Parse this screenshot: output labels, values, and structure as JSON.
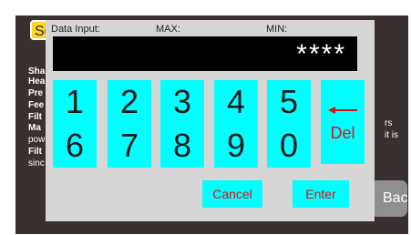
{
  "background": {
    "top_button_label": "Se",
    "labels": [
      "Sha",
      "Hea",
      "Pre",
      "Fee",
      "Filt",
      "Ma",
      "pow",
      "Filt",
      "sinc"
    ],
    "right_text": [
      "rs",
      "it is"
    ],
    "back_label": "Back"
  },
  "keypad": {
    "header": {
      "data_input": "Data Input:",
      "max": "MAX:",
      "min": "MIN:"
    },
    "display_value": "****",
    "keys": [
      "1",
      "2",
      "3",
      "4",
      "5",
      "6",
      "7",
      "8",
      "9",
      "0"
    ],
    "del_label": "Del",
    "cancel_label": "Cancel",
    "enter_label": "Enter"
  },
  "colors": {
    "key_bg": "#00ffff",
    "action_text": "#e01010",
    "dialog_bg": "#d6d6d6",
    "screen_bg": "#3a3030"
  }
}
